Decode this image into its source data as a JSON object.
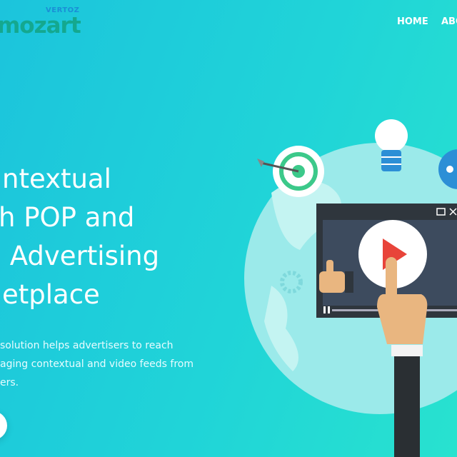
{
  "header": {
    "brand_top": "VERTOZ",
    "brand": "mozart",
    "nav": [
      "HOME",
      "ABO"
    ]
  },
  "hero": {
    "headline_lines": [
      "ntextual",
      "h POP and",
      " Advertising",
      "etplace"
    ],
    "description_lines": [
      "solution helps advertisers to reach",
      "aging contextual and video feeds from",
      "ers."
    ]
  },
  "colors": {
    "brand": "#14a88f",
    "brand_top": "#1a8fd6",
    "globe": "#9beaea",
    "play": "#e8443a",
    "target": "#3cc98a"
  }
}
